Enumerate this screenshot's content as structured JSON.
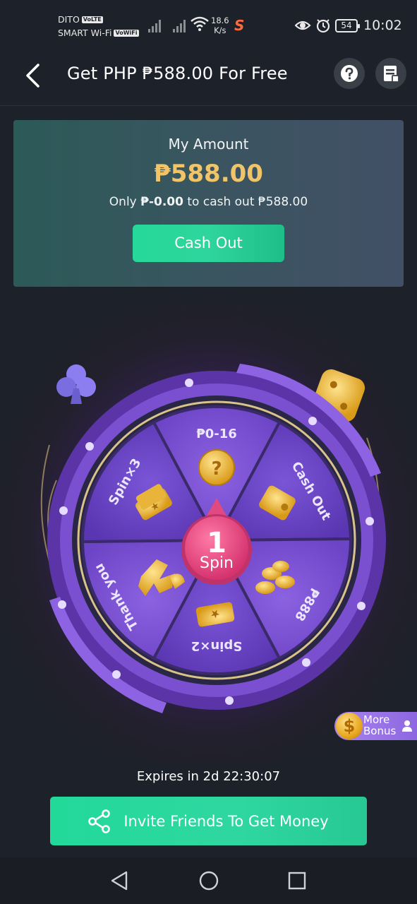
{
  "status_bar": {
    "carrier_1": "DITO",
    "carrier_1_tag": "VoLTE",
    "carrier_2": "SMART Wi-Fi",
    "carrier_2_tag": "VoWiFi",
    "net_speed_value": "18.6",
    "net_speed_unit": "K/s",
    "battery": "54",
    "time": "10:02"
  },
  "header": {
    "title": "Get PHP ₱588.00 For Free",
    "back_icon": "chevron-left-icon",
    "help_icon": "question-icon",
    "records_icon": "document-icon"
  },
  "amount_card": {
    "label": "My Amount",
    "value": "₱588.00",
    "note_prefix": "Only ",
    "note_amount": "₱-0.00",
    "note_suffix": " to cash out ₱588.00",
    "button_label": "Cash Out"
  },
  "wheel": {
    "center_count": "1",
    "center_label": "Spin",
    "segments": [
      {
        "label": "₱0-16",
        "icon": "mystery-coin-icon"
      },
      {
        "label": "Cash Out",
        "icon": "wallet-icon"
      },
      {
        "label": "₱888",
        "icon": "coin-stack-icon"
      },
      {
        "label": "Spin×2",
        "icon": "ticket-icon"
      },
      {
        "label": "Thank you",
        "icon": "ribbon-icon"
      },
      {
        "label": "Spin×3",
        "icon": "ticket-stack-icon"
      }
    ]
  },
  "more_bonus": {
    "line1": "More",
    "line2": "Bonus",
    "coin_symbol": "$"
  },
  "expires": "Expires in 2d 22:30:07",
  "invite": {
    "label": "Invite Friends To Get Money",
    "icon": "share-icon"
  },
  "nav": {
    "back": "triangle-back-icon",
    "home": "circle-home-icon",
    "recents": "square-recents-icon"
  },
  "colors": {
    "background": "#1d2129",
    "amount_gold": "#f2c468",
    "accent_green": "#25d99a",
    "wheel_purple": "#7b4fd6"
  }
}
